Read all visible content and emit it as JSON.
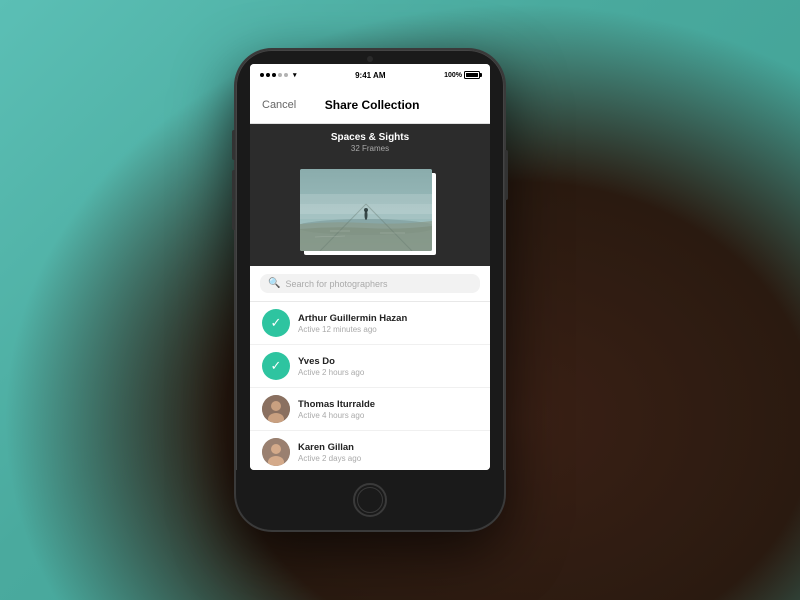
{
  "background": {
    "color": "#5bbfb5"
  },
  "statusBar": {
    "time": "9:41 AM",
    "battery": "100%",
    "signal": "●●●○○"
  },
  "navBar": {
    "cancelLabel": "Cancel",
    "title": "Share Collection"
  },
  "collection": {
    "name": "Spaces & Sights",
    "frames": "32 Frames"
  },
  "search": {
    "placeholder": "Search for photographers"
  },
  "people": [
    {
      "name": "Arthur Guillermin Hazan",
      "status": "Active 12 minutes ago",
      "selected": true,
      "avatarType": "check"
    },
    {
      "name": "Yves Do",
      "status": "Active 2 hours ago",
      "selected": true,
      "avatarType": "check"
    },
    {
      "name": "Thomas Iturralde",
      "status": "Active 4 hours ago",
      "selected": false,
      "avatarType": "photo-thomas"
    },
    {
      "name": "Karen Gillan",
      "status": "Active 2 days ago",
      "selected": false,
      "avatarType": "photo-karen"
    }
  ],
  "bottomBar": {
    "sendIcon": "➤"
  }
}
